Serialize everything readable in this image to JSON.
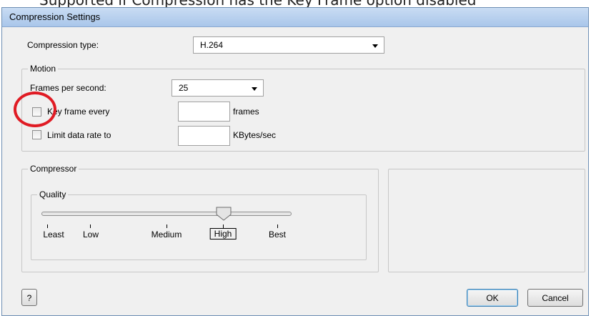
{
  "caption": "Supported if Compression has the Key Frame option disabled",
  "dialog": {
    "title": "Compression Settings",
    "compression_type": {
      "label": "Compression type:",
      "value": "H.264"
    },
    "motion": {
      "legend": "Motion",
      "fps": {
        "label": "Frames per second:",
        "value": "25"
      },
      "key_frame": {
        "label": "Key frame every",
        "value": "",
        "unit": "frames",
        "checked": false
      },
      "limit_rate": {
        "label": "Limit data rate to",
        "value": "",
        "unit": "KBytes/sec",
        "checked": false
      }
    },
    "compressor": {
      "legend": "Compressor",
      "quality": {
        "legend": "Quality",
        "selected": "High",
        "levels": [
          "Least",
          "Low",
          "Medium",
          "High",
          "Best"
        ]
      }
    },
    "buttons": {
      "help": "?",
      "ok": "OK",
      "cancel": "Cancel"
    }
  }
}
